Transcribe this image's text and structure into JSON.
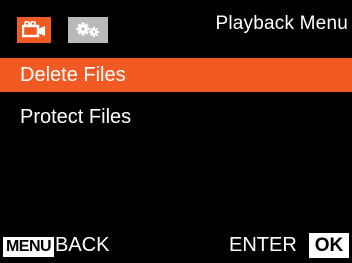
{
  "header": {
    "title": "Playback Menu",
    "tabs": [
      {
        "icon": "video-camera-icon",
        "active": true,
        "color": "#f15a22"
      },
      {
        "icon": "gears-icon",
        "active": false,
        "color": "#b9b9b9"
      }
    ]
  },
  "menu": {
    "items": [
      {
        "label": "Delete Files",
        "selected": true
      },
      {
        "label": "Protect Files",
        "selected": false
      }
    ]
  },
  "footer": {
    "menu_key": "MENU",
    "back_label": "BACK",
    "enter_label": "ENTER",
    "ok_key": "OK"
  },
  "colors": {
    "accent": "#f15a22",
    "background": "#000000",
    "inactive_tab": "#b9b9b9"
  }
}
